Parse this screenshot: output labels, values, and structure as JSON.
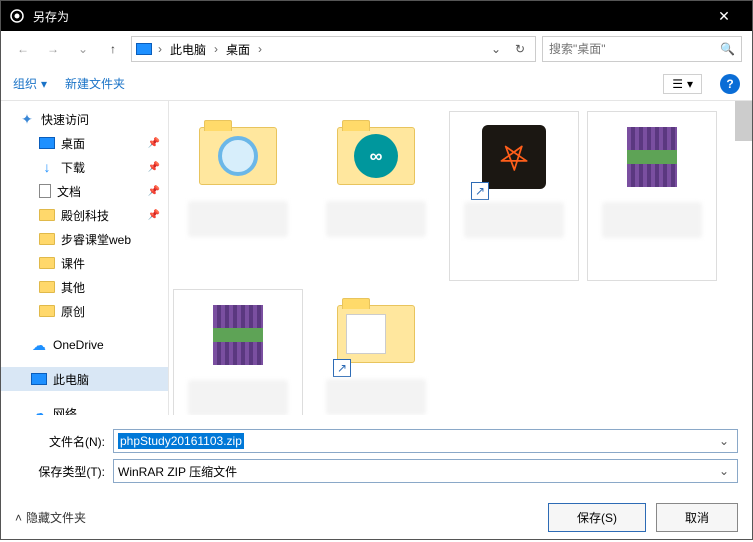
{
  "title": "另存为",
  "nav": {
    "crumb1": "此电脑",
    "crumb2": "桌面",
    "search_placeholder": "搜索\"桌面\""
  },
  "toolbar": {
    "organize": "组织",
    "new_folder": "新建文件夹"
  },
  "sidebar": {
    "quick_access": "快速访问",
    "items": [
      {
        "label": "桌面"
      },
      {
        "label": "下载"
      },
      {
        "label": "文档"
      },
      {
        "label": "殿创科技"
      },
      {
        "label": "步睿课堂web"
      },
      {
        "label": "课件"
      },
      {
        "label": "其他"
      },
      {
        "label": "原创"
      }
    ],
    "onedrive": "OneDrive",
    "this_pc": "此电脑",
    "network": "网络"
  },
  "form": {
    "filename_label": "文件名(N):",
    "filename_value": "phpStudy20161103.zip",
    "filetype_label": "保存类型(T):",
    "filetype_value": "WinRAR ZIP 压缩文件"
  },
  "footer": {
    "hide_folders": "隐藏文件夹",
    "save": "保存(S)",
    "cancel": "取消"
  }
}
